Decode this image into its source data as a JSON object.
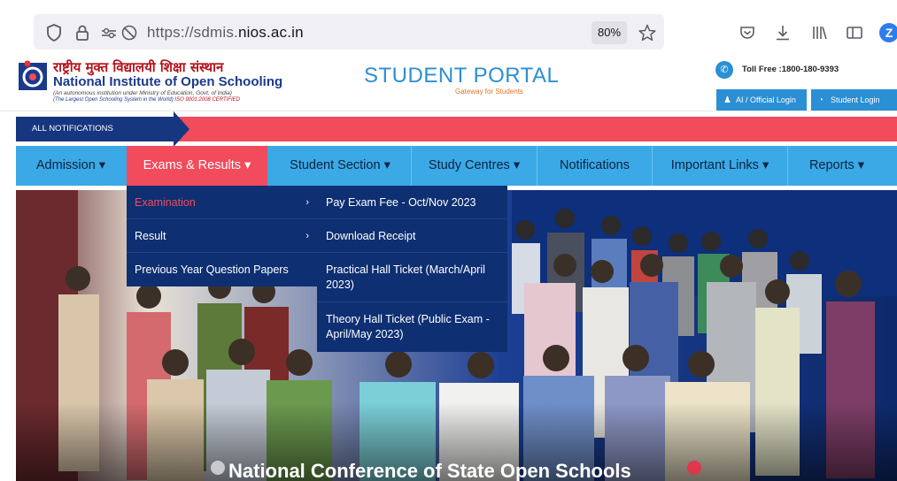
{
  "browser": {
    "url_scheme": "https://sdmis.",
    "url_host": "nios.ac.in",
    "zoom": "80%",
    "icons": [
      "shield-icon",
      "lock-icon",
      "permissions-icon",
      "tracking-off-icon",
      "star-icon",
      "pocket-icon",
      "download-icon",
      "library-icon",
      "sidebar-icon",
      "extension-z-icon"
    ],
    "ext_letter": "Z"
  },
  "header": {
    "hindi_title": "राष्ट्रीय मुक्त विद्यालयी शिक्षा संस्थान",
    "english_title_prefix": "National Institute of ",
    "english_title_bold": "Open Schooling",
    "sub1": "(An autonomous institution under Ministry of Education, Govt. of India)",
    "sub2": "(The Largest Open Schooling System in the World)",
    "iso": "ISO 9001:2008 CERTIFIED",
    "portal_title": "STUDENT PORTAL",
    "portal_tag": "Gateway for Students",
    "tollfree": "Toll Free :1800-180-9393",
    "official_login": "AI / Official Login",
    "student_login": "Student Login"
  },
  "notifications": {
    "label": "ALL NOTIFICATIONS"
  },
  "nav": {
    "items": [
      "Admission ▾",
      "Exams & Results ▾",
      "Student Section ▾",
      "Study Centres ▾",
      "Notifications",
      "Important Links ▾",
      "Reports ▾"
    ]
  },
  "menu_exams": {
    "items": [
      "Examination",
      "Result",
      "Previous Year Question Papers"
    ]
  },
  "menu_examination": {
    "items": [
      "Pay Exam Fee - Oct/Nov 2023",
      "Download Receipt",
      "Practical Hall Ticket (March/April 2023)",
      "Theory Hall Ticket (Public Exam - April/May 2023)"
    ]
  },
  "hero": {
    "caption": "National Conference of State Open Schools"
  },
  "colors": {
    "accent_blue": "#3aa9e6",
    "accent_red": "#f14b5c",
    "navy": "#0e2f72"
  }
}
